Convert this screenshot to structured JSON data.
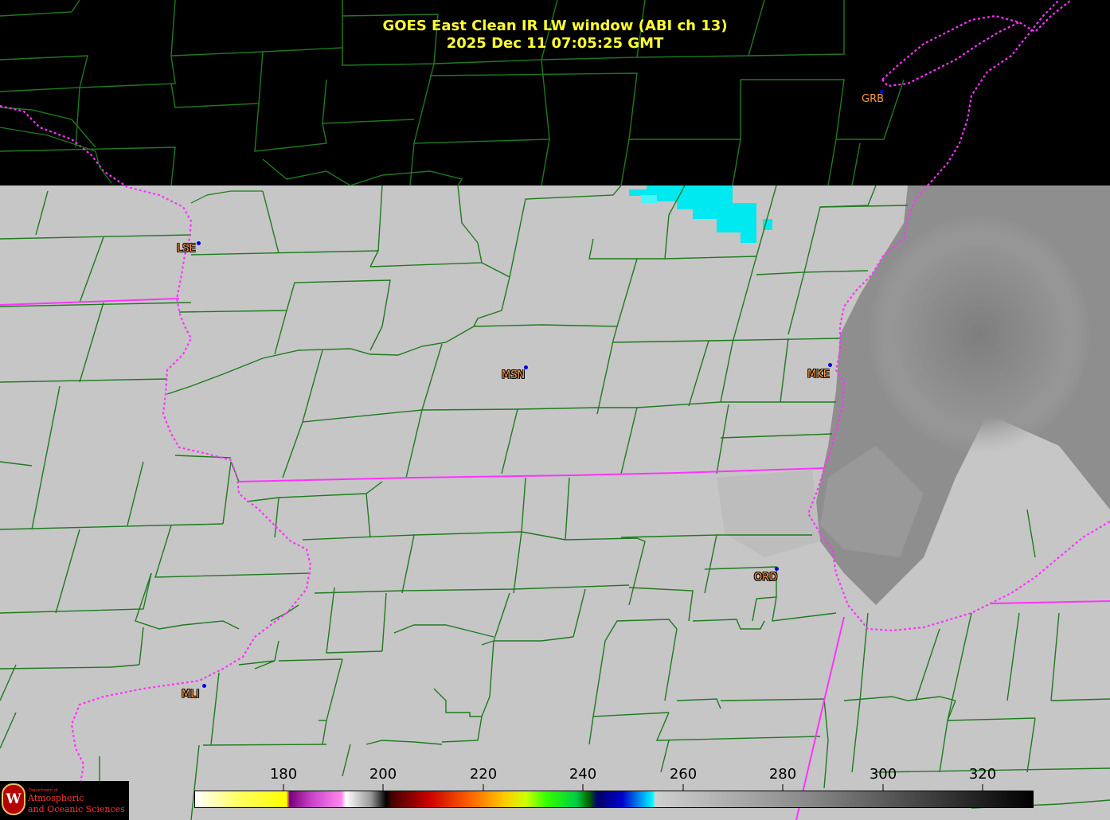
{
  "title": {
    "line1": "GOES East Clean IR LW window (ABI ch 13)",
    "line2": "2025 Dec 11  07:05:25 GMT"
  },
  "cities": [
    {
      "code": "GRB"
    },
    {
      "code": "LSE"
    },
    {
      "code": "MSN"
    },
    {
      "code": "MKE"
    },
    {
      "code": "ORD"
    },
    {
      "code": "MLI"
    }
  ],
  "colorbar": {
    "unit_ticks": [
      "180",
      "200",
      "220",
      "240",
      "260",
      "280",
      "300",
      "320"
    ],
    "colors": {
      "warm_clear": "#c8c8c8",
      "cold_cloud": "#00ffff",
      "lake_warm": "#8c8c8c"
    }
  },
  "logo": {
    "seal_letter": "W",
    "dept": "Department of",
    "name_line1": "Atmospheric",
    "name_line2": "and Oceanic Sciences"
  },
  "colors": {
    "county_lines": "#1f7a1f",
    "state_lines": "#ff33ff",
    "title_text": "#ffff33",
    "city_label": "#ff9a3c",
    "city_marker": "#0000ee"
  }
}
